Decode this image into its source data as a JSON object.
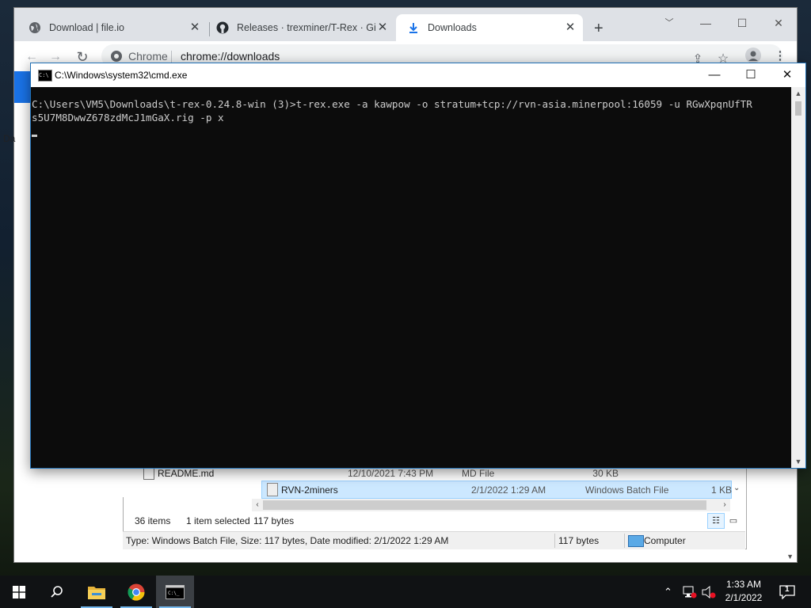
{
  "chrome": {
    "tabs": [
      {
        "title": "Download | file.io",
        "icon": "file-io-icon",
        "active": false
      },
      {
        "title": "Releases · trexminer/T-Rex · GitH",
        "icon": "github-icon",
        "active": false
      },
      {
        "title": "Downloads",
        "icon": "download-icon",
        "active": true
      }
    ],
    "omnibox_scheme_label": "Chrome",
    "omnibox_url": "chrome://downloads",
    "side_text": "Da"
  },
  "cmd": {
    "title": "C:\\Windows\\system32\\cmd.exe",
    "lines": [
      "",
      "C:\\Users\\VM5\\Downloads\\t-rex-0.24.8-win (3)>t-rex.exe -a kawpow -o stratum+tcp://rvn-asia.minerpool:16059 -u RGwXpqnUfTR",
      "s5U7M8DwwZ678zdMcJ1mGaX.rig -p x"
    ]
  },
  "explorer": {
    "files": [
      {
        "name": "README.md",
        "date": "12/10/2021 7:43 PM",
        "type": "MD File",
        "size": "30 KB",
        "selected": false
      },
      {
        "name": "RVN-2miners",
        "date": "2/1/2022 1:29 AM",
        "type": "Windows Batch File",
        "size": "1 KB",
        "selected": true
      }
    ],
    "item_count": "36 items",
    "selection": "1 item selected",
    "selection_size": "117 bytes",
    "details": "Type: Windows Batch File, Size: 117 bytes, Date modified: 2/1/2022 1:29 AM",
    "details_size": "117 bytes",
    "location": "Computer"
  },
  "taskbar": {
    "time": "1:33 AM",
    "date": "2/1/2022",
    "notification_count": "1"
  }
}
